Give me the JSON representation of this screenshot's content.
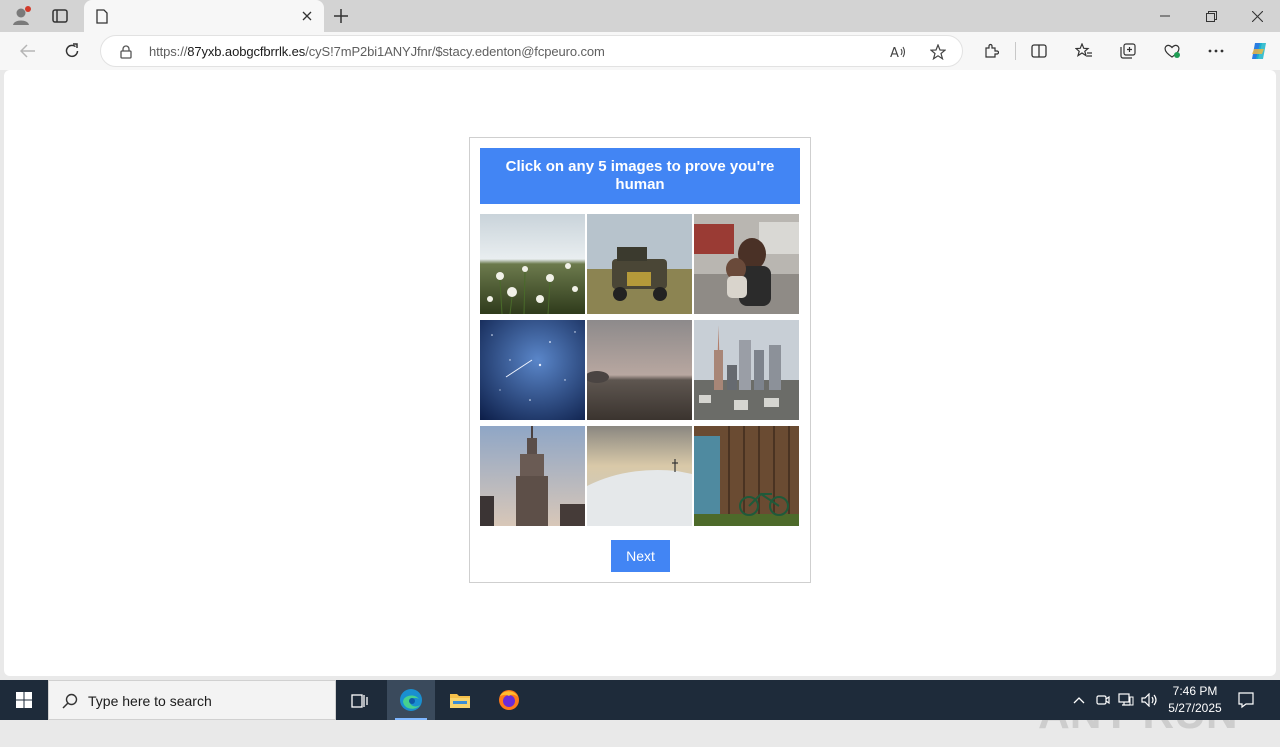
{
  "browser": {
    "tab_title": "",
    "url_prefix": "https://",
    "url_host": "87yxb.aobgcfbrrlk.es",
    "url_rest": "/cyS!7mP2bi1ANYJfnr/$stacy.edenton@fcpeuro.com"
  },
  "captcha": {
    "instruction": "Click on any 5 images to prove you're human",
    "tiles": [
      "dandelion-field",
      "vintage-truck",
      "mother-and-child-street",
      "night-sky-stars",
      "misty-beach",
      "city-skyline",
      "empire-state-building",
      "snowy-hill-cross",
      "wooden-shed-bicycle"
    ],
    "next_label": "Next",
    "accent": "#4285f4"
  },
  "watermark": {
    "text": "ANY RUN"
  },
  "taskbar": {
    "search_placeholder": "Type here to search",
    "time": "7:46 PM",
    "date": "5/27/2025"
  }
}
